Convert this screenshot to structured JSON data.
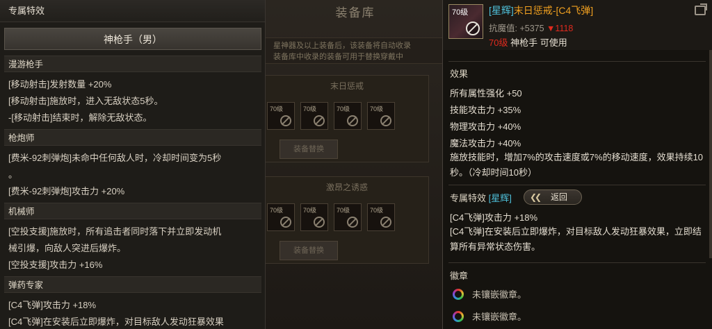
{
  "background_window": {
    "title": "装备库",
    "notice_line1": "星神器及以上装备后，该装备将自动收录",
    "notice_line2": "装备库中收录的装备可用于替换穿戴中",
    "sets": [
      {
        "title": "末日惩戒",
        "slot_level": "70级",
        "button": "装备替换"
      },
      {
        "title": "激昂之诱惑",
        "slot_level": "70级",
        "button": "装备替换"
      }
    ]
  },
  "left_panel": {
    "header": "专属特效",
    "class_name": "神枪手（男）",
    "sections": [
      {
        "title": "漫游枪手",
        "lines": [
          "[移动射击]发射数量 +20%",
          "[移动射击]施放时，进入无敌状态5秒。",
          "-[移动射击]结束时，解除无敌状态。"
        ]
      },
      {
        "title": "枪炮师",
        "lines": [
          "[费米-92刺弹炮]未命中任何敌人时，冷却时间变为5秒",
          "。",
          "[费米-92刺弹炮]攻击力 +20%"
        ]
      },
      {
        "title": "机械师",
        "lines": [
          "[空投支援]施放时，所有追击者同时落下并立即发动机",
          "械引爆，向敌人突进后爆炸。",
          "[空投支援]攻击力 +16%"
        ]
      },
      {
        "title": "弹药专家",
        "lines": [
          "[C4飞弹]攻击力 +18%",
          "[C4飞弹]在安装后立即爆炸，对目标敌人发动狂暴效果"
        ]
      }
    ]
  },
  "tooltip": {
    "icon_level": "70级",
    "name_tag": "[星辉]",
    "name": "末日惩戒-[C4飞弹]",
    "resist_label": "抗魔值: +5375",
    "resist_delta": "▼1118",
    "req_level": "70级",
    "req_class": "神枪手 可使用",
    "effects_title": "效果",
    "effects": [
      "所有属性强化 +50",
      "技能攻击力 +35%",
      "物理攻击力 +40%",
      "魔法攻击力 +40%",
      "施放技能时，增加7%的攻击速度或7%的移动速度，效果持续10秒。（冷却时间10秒）"
    ],
    "exclusive_title": "专属特效",
    "exclusive_tag": "[星辉]",
    "back_button": "返回",
    "exclusive_lines": [
      "[C4飞弹]攻击力 +18%",
      "[C4飞弹]在安装后立即爆炸，对目标敌人发动狂暴效果，立即结算所有异常状态伤害。"
    ],
    "emblem_title": "徽章",
    "emblems": [
      "未镶嵌徽章。",
      "未镶嵌徽章。"
    ]
  }
}
